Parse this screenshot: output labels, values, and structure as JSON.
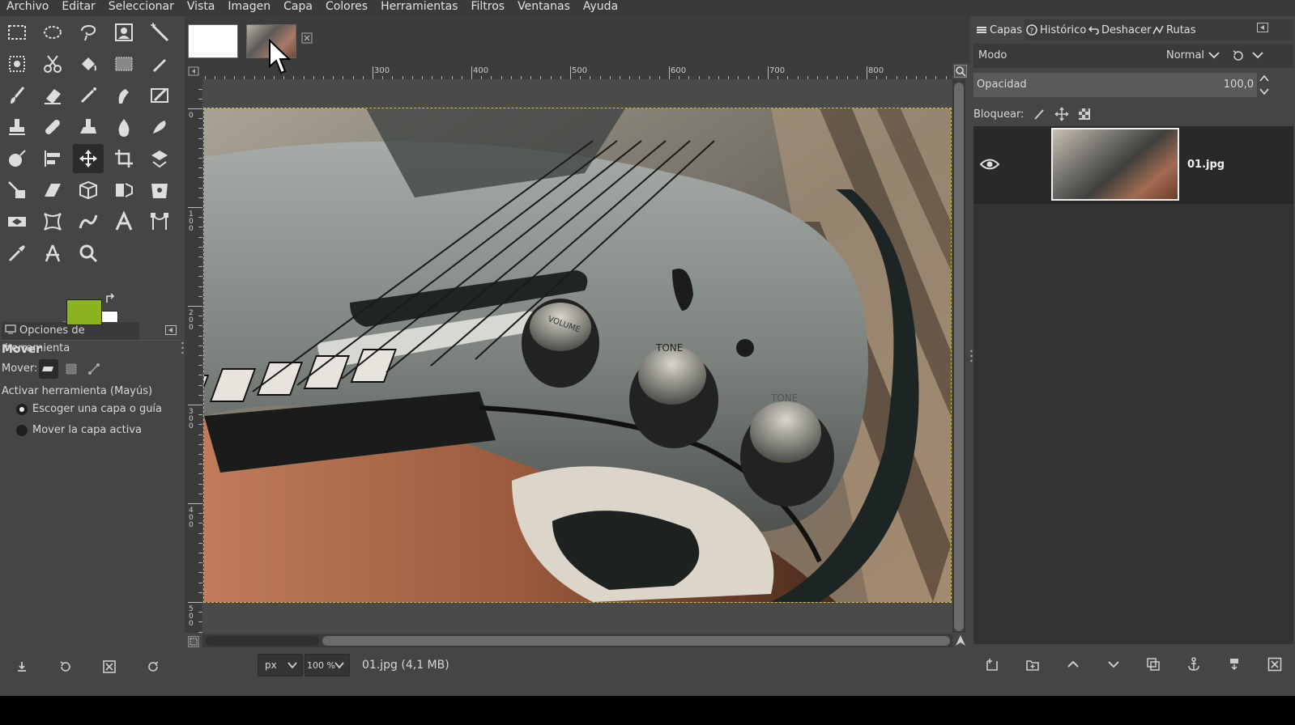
{
  "menubar": {
    "items": [
      "Archivo",
      "Editar",
      "Seleccionar",
      "Vista",
      "Imagen",
      "Capa",
      "Colores",
      "Herramientas",
      "Filtros",
      "Ventanas",
      "Ayuda"
    ]
  },
  "toolbox": {
    "fg_color": "#8ab31e",
    "bg_color": "#ffffff",
    "active_tool": "move-tool"
  },
  "tool_options": {
    "tab_label": "Opciones de herramienta",
    "title": "Mover",
    "move_label": "Mover:",
    "activate_label": "Activar herramienta  (Mayús)",
    "radio_pick": "Escoger una capa o guía",
    "radio_active": "Mover la capa activa"
  },
  "rulers": {
    "top_labels": [
      "300",
      "400",
      "500",
      "600",
      "700",
      "800"
    ],
    "left_labels": [
      "0",
      "100",
      "200",
      "300",
      "400",
      "500"
    ]
  },
  "statusbar": {
    "unit": "px",
    "zoom": "100 %",
    "file_info": "01.jpg (4,1 MB)"
  },
  "dock": {
    "tabs": [
      "Capas",
      "Histórico",
      "Deshacer",
      "Rutas"
    ],
    "mode_label": "Modo",
    "mode_value": "Normal",
    "opacity_label": "Opacidad",
    "opacity_value": "100,0",
    "lock_label": "Bloquear:",
    "layer_name": "01.jpg"
  },
  "canvas_text": {
    "knob1": "VOLUME",
    "knob2": "TONE",
    "knob3": "TONE"
  }
}
